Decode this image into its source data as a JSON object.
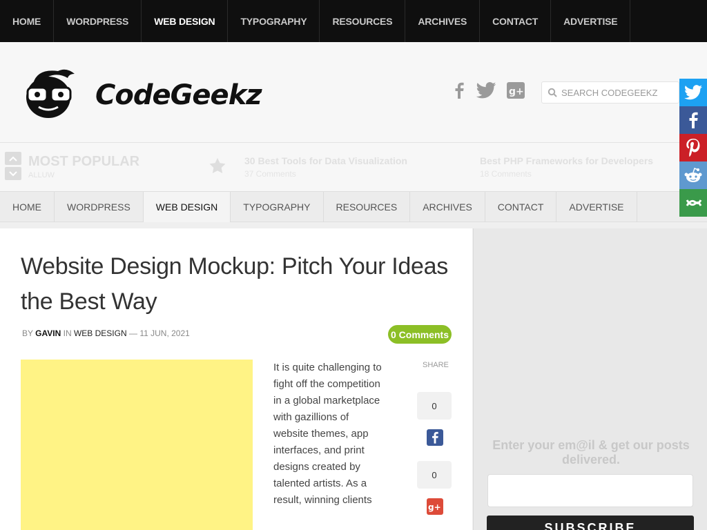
{
  "top_nav": [
    "HOME",
    "WORDPRESS",
    "WEB DESIGN",
    "TYPOGRAPHY",
    "RESOURCES",
    "ARCHIVES",
    "CONTACT",
    "ADVERTISE"
  ],
  "secondary_nav": [
    "HOME",
    "WORDPRESS",
    "WEB DESIGN",
    "TYPOGRAPHY",
    "RESOURCES",
    "ARCHIVES",
    "CONTACT",
    "ADVERTISE"
  ],
  "active_nav": "WEB DESIGN",
  "logo": {
    "text": "CodeGeekz"
  },
  "search": {
    "placeholder": "SEARCH CODEGEEKZ"
  },
  "popular": {
    "title": "MOST POPULAR",
    "subtitle": "ALLUW",
    "items": [
      {
        "title": "30 Best Tools for Data Visualization",
        "meta": "37 Comments"
      },
      {
        "title": "Best PHP Frameworks for Developers",
        "meta": "18 Comments"
      }
    ]
  },
  "post": {
    "title": "Website Design Mockup: Pitch Your Ideas the Best Way",
    "by_label": "BY",
    "author": "GAVIN",
    "in_label": "IN",
    "category": "WEB DESIGN",
    "date": "— 11 JUN, 2021",
    "comments": "0 Comments",
    "body": "It is quite challenging to fight off the competition in a global marketplace with gazillions of website themes, app interfaces, and print designs created by talented artists. As a result, winning clients"
  },
  "share": {
    "label": "SHARE",
    "facebook_count": "0",
    "googleplus_count": "0"
  },
  "subscribe": {
    "text": "Enter your em@il & get our posts delivered.",
    "button": "SUBSCRIBE"
  },
  "colors": {
    "twitter": "#1da1f2",
    "facebook": "#3b5998",
    "pinterest": "#cb2027",
    "reddit": "#5f99cf",
    "more": "#3a9a4a",
    "comments_badge": "#8cbf26",
    "gplus": "#dd4b39",
    "featured_placeholder": "#fff385"
  }
}
